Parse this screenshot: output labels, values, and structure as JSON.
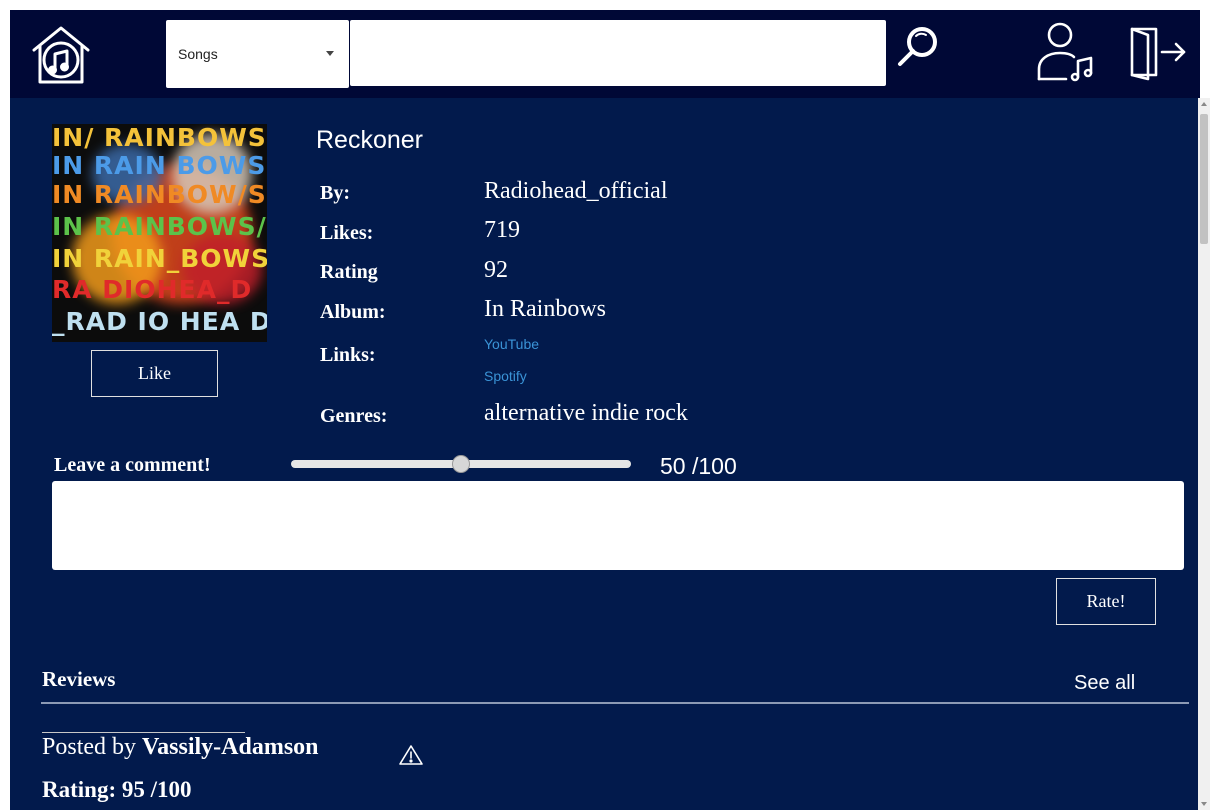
{
  "header": {
    "search_category": "Songs",
    "search_placeholder": "",
    "search_value": ""
  },
  "song": {
    "title": "Reckoner",
    "by_label": "By:",
    "by_value": "Radiohead_official",
    "likes_label": "Likes:",
    "likes_value": "719",
    "rating_label": "Rating",
    "rating_value": "92",
    "album_label": "Album:",
    "album_value": "In Rainbows",
    "links_label": "Links:",
    "link_youtube": "YouTube",
    "link_spotify": "Spotify",
    "genres_label": "Genres:",
    "genres_value": "alternative indie rock",
    "like_button": "Like"
  },
  "album_art": {
    "lines": [
      "IN/ RAINBOWS",
      "IN RAIN BOWS",
      "IN RAINBOW/S",
      "IN RAINBOWS/",
      "IN RAIN_BOWS",
      "RA DIOHEA_D",
      "_RAD IO HEA D"
    ]
  },
  "comment": {
    "label": "Leave a comment!",
    "slider_value": 50,
    "slider_max": 100,
    "slider_text": "50 /100",
    "text": "",
    "rate_button": "Rate!"
  },
  "reviews": {
    "title": "Reviews",
    "see_all": "See all",
    "items": [
      {
        "posted_prefix": "Posted by ",
        "author": "Vassily-Adamson",
        "rating_text": "Rating: 95 /100"
      }
    ]
  },
  "colors": {
    "topbar": "#000836",
    "content_bg": "#021a4c",
    "link": "#3a93d6"
  }
}
